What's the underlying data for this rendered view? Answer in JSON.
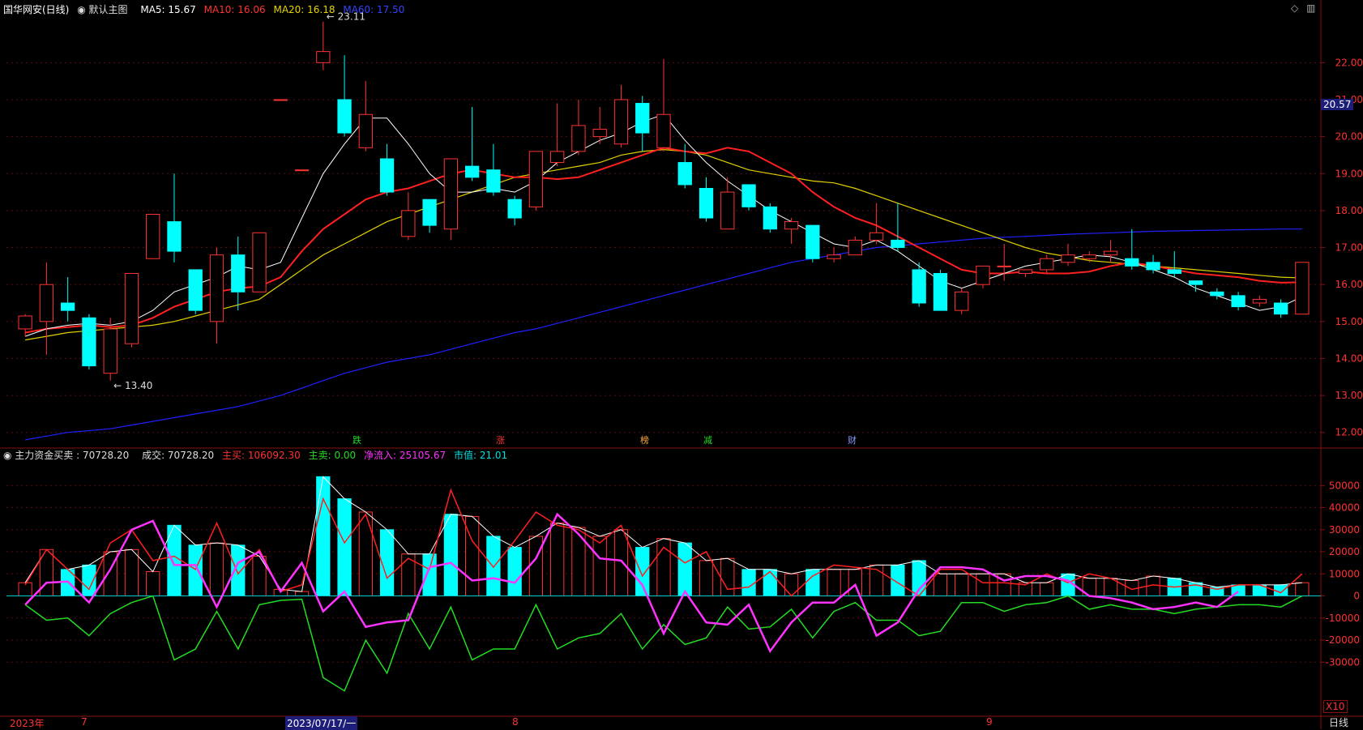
{
  "header": {
    "stock": "国华网安(日线)",
    "template": "默认主图",
    "ma5": "MA5: 15.67",
    "ma10": "MA10: 16.06",
    "ma20": "MA20: 16.18",
    "ma60": "MA60: 17.50"
  },
  "sub_header": {
    "name": "主力资金买卖 : 70728.20",
    "volume": "成交: 70728.20",
    "buy": "主买: 106092.30",
    "sell": "主卖: 0.00",
    "net": "净流入: 25105.67",
    "mktval": "市值: 21.01"
  },
  "current_price": "20.57",
  "x10": "X10",
  "period": "日线",
  "x_labels": [
    "2023年",
    "7",
    "2023/07/17/一",
    "8",
    "9"
  ],
  "events": [
    "跌",
    "涨",
    "榜",
    "减",
    "财"
  ],
  "colors": {
    "up": "#ff3333",
    "down": "#00ffff",
    "ma5": "#ffffff",
    "ma10": "#ff2020",
    "ma20": "#e0d000",
    "ma60": "#2020ff",
    "net": "#ff33ff",
    "sell": "#22dd22"
  },
  "chart_data": [
    {
      "type": "candlestick",
      "title": "国华网安(日线)",
      "y_ticks": [
        22.0,
        21.0,
        20.0,
        19.0,
        18.0,
        17.0,
        16.0,
        15.0,
        14.0,
        13.0,
        12.0
      ],
      "ylim": [
        11.6,
        23.3
      ],
      "annotations": [
        {
          "label": "23.11",
          "index": 14
        },
        {
          "label": "13.40",
          "index": 4
        }
      ],
      "candles": [
        {
          "o": 14.8,
          "c": 15.15,
          "h": 15.2,
          "l": 14.6
        },
        {
          "o": 15.0,
          "c": 16.0,
          "h": 16.6,
          "l": 14.1
        },
        {
          "o": 15.5,
          "c": 15.3,
          "h": 16.2,
          "l": 15.0
        },
        {
          "o": 15.1,
          "c": 13.8,
          "h": 15.2,
          "l": 13.7
        },
        {
          "o": 13.6,
          "c": 14.8,
          "h": 15.1,
          "l": 13.4
        },
        {
          "o": 14.4,
          "c": 16.3,
          "h": 16.3,
          "l": 14.3
        },
        {
          "o": 16.7,
          "c": 17.9,
          "h": 17.9,
          "l": 16.7
        },
        {
          "o": 17.7,
          "c": 16.9,
          "h": 19.0,
          "l": 16.6
        },
        {
          "o": 16.4,
          "c": 15.3,
          "h": 16.4,
          "l": 15.2
        },
        {
          "o": 15.0,
          "c": 16.8,
          "h": 17.0,
          "l": 14.4
        },
        {
          "o": 16.8,
          "c": 15.8,
          "h": 17.3,
          "l": 15.3
        },
        {
          "o": 15.8,
          "c": 17.4,
          "h": 17.4,
          "l": 15.8
        },
        {
          "o": 21.0,
          "c": 21.0,
          "h": 21.0,
          "l": 21.0
        },
        {
          "o": 19.1,
          "c": 19.1,
          "h": 19.1,
          "l": 19.1
        },
        {
          "o": 22.0,
          "c": 22.3,
          "h": 23.11,
          "l": 21.8
        },
        {
          "o": 21.0,
          "c": 20.1,
          "h": 22.2,
          "l": 20.0
        },
        {
          "o": 19.7,
          "c": 20.6,
          "h": 21.5,
          "l": 19.6
        },
        {
          "o": 19.4,
          "c": 18.5,
          "h": 19.8,
          "l": 18.4
        },
        {
          "o": 17.3,
          "c": 18.0,
          "h": 18.5,
          "l": 17.2
        },
        {
          "o": 18.3,
          "c": 17.6,
          "h": 18.3,
          "l": 17.4
        },
        {
          "o": 17.5,
          "c": 19.4,
          "h": 19.4,
          "l": 17.2
        },
        {
          "o": 19.2,
          "c": 18.9,
          "h": 20.8,
          "l": 18.8
        },
        {
          "o": 19.1,
          "c": 18.5,
          "h": 19.8,
          "l": 18.4
        },
        {
          "o": 18.3,
          "c": 17.8,
          "h": 18.4,
          "l": 17.6
        },
        {
          "o": 18.1,
          "c": 19.6,
          "h": 19.6,
          "l": 18.0
        },
        {
          "o": 19.3,
          "c": 19.6,
          "h": 20.9,
          "l": 19.2
        },
        {
          "o": 19.6,
          "c": 20.3,
          "h": 21.0,
          "l": 19.5
        },
        {
          "o": 20.0,
          "c": 20.2,
          "h": 20.8,
          "l": 19.8
        },
        {
          "o": 19.8,
          "c": 21.0,
          "h": 21.4,
          "l": 19.7
        },
        {
          "o": 20.9,
          "c": 20.1,
          "h": 21.1,
          "l": 19.6
        },
        {
          "o": 19.7,
          "c": 20.6,
          "h": 22.1,
          "l": 19.6
        },
        {
          "o": 19.3,
          "c": 18.7,
          "h": 19.8,
          "l": 18.6
        },
        {
          "o": 18.6,
          "c": 17.8,
          "h": 18.9,
          "l": 17.7
        },
        {
          "o": 17.5,
          "c": 18.5,
          "h": 18.9,
          "l": 17.5
        },
        {
          "o": 18.7,
          "c": 18.1,
          "h": 18.7,
          "l": 18.0
        },
        {
          "o": 18.1,
          "c": 17.5,
          "h": 18.2,
          "l": 17.4
        },
        {
          "o": 17.5,
          "c": 17.7,
          "h": 17.8,
          "l": 17.1
        },
        {
          "o": 17.6,
          "c": 16.7,
          "h": 17.6,
          "l": 16.6
        },
        {
          "o": 16.7,
          "c": 16.8,
          "h": 17.0,
          "l": 16.6
        },
        {
          "o": 16.8,
          "c": 17.2,
          "h": 17.3,
          "l": 16.8
        },
        {
          "o": 17.2,
          "c": 17.4,
          "h": 18.2,
          "l": 17.1
        },
        {
          "o": 17.2,
          "c": 17.0,
          "h": 18.2,
          "l": 16.9
        },
        {
          "o": 16.4,
          "c": 15.5,
          "h": 16.6,
          "l": 15.4
        },
        {
          "o": 16.3,
          "c": 15.3,
          "h": 16.4,
          "l": 15.3
        },
        {
          "o": 15.3,
          "c": 15.8,
          "h": 15.9,
          "l": 15.2
        },
        {
          "o": 16.0,
          "c": 16.5,
          "h": 16.5,
          "l": 15.9
        },
        {
          "o": 16.5,
          "c": 16.5,
          "h": 17.1,
          "l": 16.1
        },
        {
          "o": 16.3,
          "c": 16.4,
          "h": 16.4,
          "l": 16.2
        },
        {
          "o": 16.4,
          "c": 16.7,
          "h": 16.8,
          "l": 16.3
        },
        {
          "o": 16.6,
          "c": 16.8,
          "h": 17.1,
          "l": 16.5
        },
        {
          "o": 16.7,
          "c": 16.8,
          "h": 16.9,
          "l": 16.6
        },
        {
          "o": 16.8,
          "c": 16.9,
          "h": 17.2,
          "l": 16.6
        },
        {
          "o": 16.7,
          "c": 16.5,
          "h": 17.5,
          "l": 16.4
        },
        {
          "o": 16.6,
          "c": 16.4,
          "h": 16.8,
          "l": 16.3
        },
        {
          "o": 16.4,
          "c": 16.3,
          "h": 16.9,
          "l": 16.2
        },
        {
          "o": 16.1,
          "c": 16.0,
          "h": 16.1,
          "l": 15.8
        },
        {
          "o": 15.8,
          "c": 15.7,
          "h": 15.9,
          "l": 15.6
        },
        {
          "o": 15.7,
          "c": 15.4,
          "h": 15.8,
          "l": 15.3
        },
        {
          "o": 15.5,
          "c": 15.6,
          "h": 15.7,
          "l": 15.4
        },
        {
          "o": 15.5,
          "c": 15.2,
          "h": 15.6,
          "l": 15.1
        },
        {
          "o": 15.2,
          "c": 16.6,
          "h": 16.6,
          "l": 15.2
        }
      ],
      "ma5": [
        14.6,
        14.8,
        14.9,
        14.95,
        14.9,
        15.0,
        15.3,
        15.8,
        16.0,
        16.2,
        16.5,
        16.4,
        16.6,
        17.8,
        19.0,
        19.8,
        20.5,
        20.5,
        19.8,
        19.0,
        18.5,
        18.5,
        18.6,
        18.5,
        18.8,
        19.3,
        19.6,
        19.9,
        20.1,
        20.4,
        20.6,
        19.9,
        19.3,
        18.8,
        18.4,
        18.0,
        17.7,
        17.4,
        17.1,
        17.0,
        17.2,
        16.9,
        16.5,
        16.1,
        15.9,
        16.1,
        16.3,
        16.5,
        16.6,
        16.7,
        16.8,
        16.75,
        16.6,
        16.4,
        16.2,
        15.9,
        15.7,
        15.5,
        15.3,
        15.4,
        15.67
      ],
      "ma10": [
        14.7,
        14.8,
        14.85,
        14.9,
        14.85,
        14.9,
        15.1,
        15.4,
        15.6,
        15.8,
        15.9,
        15.95,
        16.2,
        16.9,
        17.5,
        17.9,
        18.3,
        18.5,
        18.6,
        18.8,
        19.0,
        19.1,
        19.0,
        18.9,
        18.9,
        18.85,
        18.9,
        19.1,
        19.3,
        19.5,
        19.7,
        19.6,
        19.55,
        19.7,
        19.6,
        19.3,
        19.0,
        18.5,
        18.1,
        17.8,
        17.6,
        17.3,
        17.0,
        16.7,
        16.4,
        16.3,
        16.3,
        16.35,
        16.3,
        16.3,
        16.35,
        16.5,
        16.6,
        16.5,
        16.4,
        16.3,
        16.25,
        16.2,
        16.1,
        16.05,
        16.06
      ],
      "ma20": [
        14.5,
        14.6,
        14.7,
        14.75,
        14.8,
        14.85,
        14.9,
        15.0,
        15.15,
        15.3,
        15.45,
        15.6,
        16.0,
        16.4,
        16.8,
        17.1,
        17.4,
        17.7,
        17.9,
        18.1,
        18.3,
        18.5,
        18.7,
        18.9,
        19.0,
        19.1,
        19.2,
        19.3,
        19.5,
        19.6,
        19.65,
        19.6,
        19.5,
        19.3,
        19.1,
        19.0,
        18.9,
        18.8,
        18.75,
        18.6,
        18.4,
        18.2,
        18.0,
        17.8,
        17.6,
        17.4,
        17.2,
        17.0,
        16.85,
        16.75,
        16.65,
        16.6,
        16.55,
        16.5,
        16.45,
        16.4,
        16.35,
        16.3,
        16.25,
        16.2,
        16.18
      ],
      "ma60": [
        11.8,
        11.9,
        12.0,
        12.05,
        12.1,
        12.2,
        12.3,
        12.4,
        12.5,
        12.6,
        12.7,
        12.85,
        13.0,
        13.2,
        13.4,
        13.6,
        13.75,
        13.9,
        14.0,
        14.1,
        14.25,
        14.4,
        14.55,
        14.7,
        14.8,
        14.95,
        15.1,
        15.25,
        15.4,
        15.55,
        15.7,
        15.85,
        16.0,
        16.15,
        16.3,
        16.45,
        16.6,
        16.7,
        16.8,
        16.9,
        17.0,
        17.05,
        17.1,
        17.15,
        17.2,
        17.25,
        17.28,
        17.3,
        17.33,
        17.36,
        17.38,
        17.4,
        17.42,
        17.44,
        17.45,
        17.46,
        17.47,
        17.48,
        17.49,
        17.5,
        17.5
      ]
    },
    {
      "type": "bar",
      "title": "主力资金买卖",
      "y_ticks": [
        50000,
        40000,
        30000,
        20000,
        10000,
        0,
        -10000,
        -20000,
        -30000
      ],
      "ylim": [
        -53000,
        60000
      ],
      "bars": [
        6000,
        21000,
        12000,
        14000,
        20000,
        21000,
        11000,
        32000,
        23000,
        24000,
        23000,
        18000,
        3000,
        2000,
        54000,
        44000,
        38000,
        30000,
        19000,
        19000,
        37000,
        36000,
        27000,
        22000,
        27000,
        33000,
        31000,
        27000,
        30000,
        22000,
        26000,
        24000,
        16000,
        17000,
        12000,
        12000,
        10000,
        12000,
        12000,
        12000,
        14000,
        14000,
        16000,
        10000,
        10000,
        10000,
        10000,
        6000,
        6000,
        10000,
        8000,
        8000,
        7000,
        9000,
        8000,
        6000,
        4000,
        5000,
        5000,
        5000,
        6000
      ],
      "bar_color_index_down": [
        2,
        3,
        7,
        8,
        10,
        14,
        15,
        17,
        19,
        20,
        22,
        23,
        29,
        31,
        34,
        35,
        37,
        41,
        42,
        49,
        54,
        55,
        56,
        57,
        58,
        59
      ],
      "line_white": [
        6000,
        21000,
        12000,
        14000,
        20000,
        21000,
        11000,
        32000,
        23000,
        24000,
        23000,
        18000,
        3000,
        2000,
        54000,
        44000,
        38000,
        30000,
        19000,
        19000,
        37000,
        36000,
        27000,
        22000,
        27000,
        33000,
        31000,
        27000,
        30000,
        22000,
        26000,
        24000,
        16000,
        17000,
        12000,
        12000,
        10000,
        12000,
        12000,
        12000,
        14000,
        14000,
        16000,
        10000,
        10000,
        10000,
        10000,
        6000,
        6000,
        10000,
        8000,
        8000,
        7000,
        9000,
        8000,
        6000,
        4000,
        5000,
        5000,
        5000,
        6000
      ],
      "line_red": [
        5000,
        21000,
        12000,
        3000,
        24000,
        30000,
        16000,
        18000,
        12000,
        33000,
        10000,
        21000,
        2000,
        5000,
        44000,
        24000,
        37000,
        8000,
        17000,
        12000,
        48000,
        25000,
        13000,
        25000,
        38000,
        32000,
        30000,
        24000,
        32000,
        9000,
        22000,
        15000,
        20000,
        3000,
        4000,
        11000,
        0,
        9000,
        14000,
        13000,
        12000,
        6000,
        0,
        12000,
        12000,
        6000,
        6000,
        5000,
        10000,
        6000,
        10000,
        8000,
        3000,
        5000,
        4000,
        5000,
        3000,
        5000,
        5000,
        1500,
        10000
      ],
      "line_magenta": [
        -4000,
        6000,
        6500,
        -3000,
        12000,
        30000,
        34000,
        14000,
        14000,
        -5000,
        15000,
        20000,
        2000,
        15000,
        -7000,
        2000,
        -14000,
        -12000,
        -11000,
        13000,
        15000,
        7000,
        8000,
        6000,
        17000,
        37000,
        28000,
        17000,
        16000,
        5000,
        -17000,
        2000,
        -12000,
        -13000,
        -4000,
        -25000,
        -12000,
        -3000,
        -3000,
        5000,
        -18000,
        -12000,
        3000,
        13000,
        13000,
        12000,
        7000,
        9000,
        9000,
        7000,
        0,
        -1000,
        -3000,
        -6000,
        -5000,
        -3000,
        -5000,
        2000
      ],
      "line_green": [
        -4000,
        -11000,
        -10000,
        -18000,
        -8000,
        -3000,
        0,
        -29000,
        -24000,
        -7000,
        -24000,
        -4000,
        -2000,
        -1500,
        -37000,
        -43000,
        -20000,
        -35000,
        -8000,
        -24000,
        -5000,
        -29000,
        -24000,
        -24000,
        -4000,
        -24000,
        -19000,
        -17000,
        -8000,
        -24000,
        -13000,
        -22000,
        -19000,
        -5000,
        -15000,
        -14000,
        -6000,
        -19000,
        -7000,
        -3000,
        -11000,
        -11000,
        -18000,
        -16000,
        -3000,
        -3000,
        -7000,
        -4000,
        -3000,
        0,
        -6000,
        -4000,
        -6000,
        -6000,
        -8000,
        -6000,
        -5000,
        -4000,
        -4000,
        -5000,
        0
      ]
    }
  ]
}
